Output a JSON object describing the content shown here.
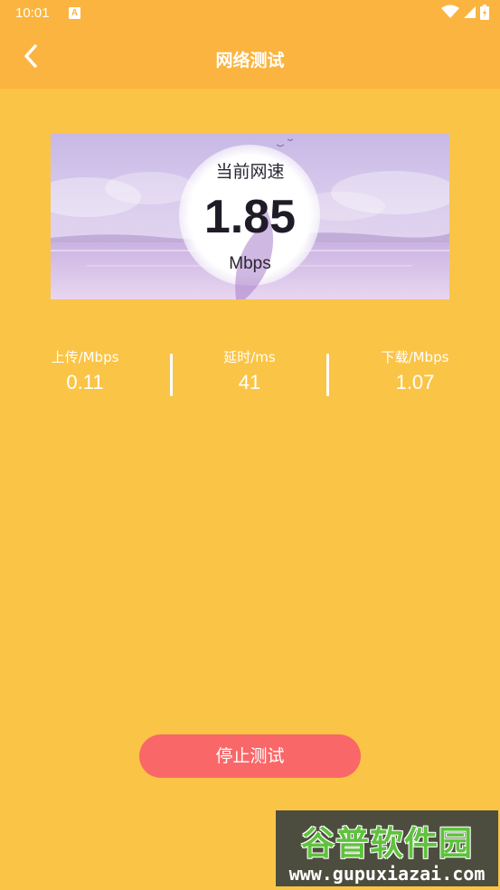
{
  "status_bar": {
    "time": "10:01",
    "notification_icon": "a-icon",
    "icons": [
      "wifi-icon",
      "signal-icon",
      "battery-icon"
    ]
  },
  "app_bar": {
    "title": "网络测试",
    "back_icon": "chevron-left-icon"
  },
  "speed_card": {
    "title": "当前网速",
    "value": "1.85",
    "unit": "Mbps"
  },
  "stats": [
    {
      "label": "上传/Mbps",
      "value": "0.11"
    },
    {
      "label": "延时/ms",
      "value": "41"
    },
    {
      "label": "下载/Mbps",
      "value": "1.07"
    }
  ],
  "stop_button": {
    "label": "停止测试"
  },
  "watermark": {
    "top": "谷普软件园",
    "bottom": "www.gupuxiazai.com"
  },
  "colors": {
    "background": "#FAC446",
    "app_bar": "#FBB43F",
    "button": "#FA6768",
    "text_dark": "#1f1c28"
  }
}
